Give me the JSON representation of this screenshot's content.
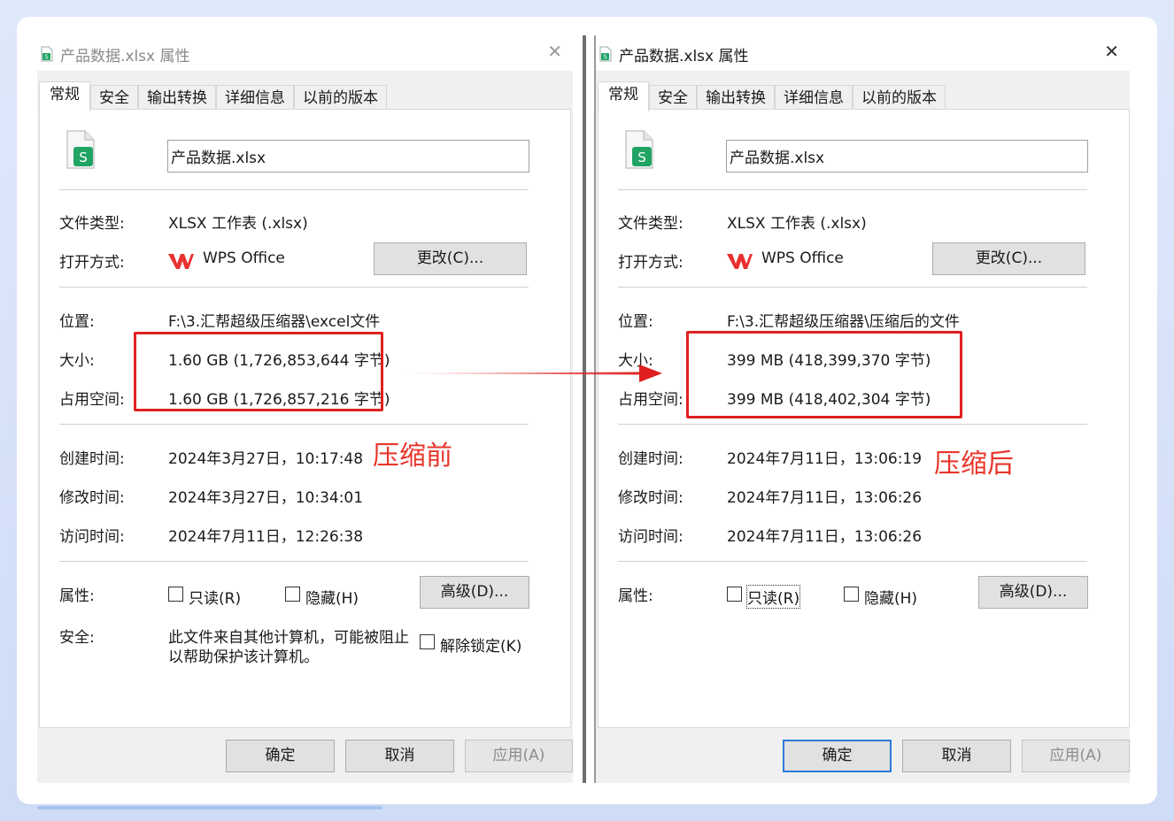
{
  "before": {
    "window_title": "产品数据.xlsx 属性",
    "close_icon": "close-icon",
    "tabs": [
      "常规",
      "安全",
      "输出转换",
      "详细信息",
      "以前的版本"
    ],
    "file_name": "产品数据.xlsx",
    "file_type_label": "文件类型:",
    "file_type_value": "XLSX 工作表 (.xlsx)",
    "open_with_label": "打开方式:",
    "open_with_app": "WPS Office",
    "change_button": "更改(C)...",
    "location_label": "位置:",
    "location_value": "F:\\3.汇帮超级压缩器\\excel文件",
    "size_label": "大小:",
    "size_value": "1.60 GB (1,726,853,644 字节)",
    "disk_size_label": "占用空间:",
    "disk_size_value": "1.60 GB (1,726,857,216 字节)",
    "created_label": "创建时间:",
    "created_value": "2024年3月27日，10:17:48",
    "modified_label": "修改时间:",
    "modified_value": "2024年3月27日，10:34:01",
    "accessed_label": "访问时间:",
    "accessed_value": "2024年7月11日，12:26:38",
    "attributes_label": "属性:",
    "readonly_label": "只读(R)",
    "hidden_label": "隐藏(H)",
    "advanced_button": "高级(D)...",
    "security_label": "安全:",
    "security_text_line1": "此文件来自其他计算机，可能被阻止",
    "security_text_line2": "以帮助保护该计算机。",
    "unblock_label": "解除锁定(K)",
    "ok_button": "确定",
    "cancel_button": "取消",
    "apply_button": "应用(A)"
  },
  "after": {
    "window_title": "产品数据.xlsx 属性",
    "close_icon": "close-icon",
    "tabs": [
      "常规",
      "安全",
      "输出转换",
      "详细信息",
      "以前的版本"
    ],
    "file_name": "产品数据.xlsx",
    "file_type_label": "文件类型:",
    "file_type_value": "XLSX 工作表 (.xlsx)",
    "open_with_label": "打开方式:",
    "open_with_app": "WPS Office",
    "change_button": "更改(C)...",
    "location_label": "位置:",
    "location_value": "F:\\3.汇帮超级压缩器\\压缩后的文件",
    "size_label": "大小:",
    "size_value": "399 MB (418,399,370 字节)",
    "disk_size_label": "占用空间:",
    "disk_size_value": "399 MB (418,402,304 字节)",
    "created_label": "创建时间:",
    "created_value": "2024年7月11日，13:06:19",
    "modified_label": "修改时间:",
    "modified_value": "2024年7月11日，13:06:26",
    "accessed_label": "访问时间:",
    "accessed_value": "2024年7月11日，13:06:26",
    "attributes_label": "属性:",
    "readonly_label": "只读(R)",
    "hidden_label": "隐藏(H)",
    "advanced_button": "高级(D)...",
    "ok_button": "确定",
    "cancel_button": "取消",
    "apply_button": "应用(A)"
  },
  "annotations": {
    "before_label": "压缩前",
    "after_label": "压缩后",
    "highlight_color": "#e02020"
  },
  "colors": {
    "sheet_icon_green": "#1fa463",
    "wps_red": "#e8312f",
    "default_button_border": "#2d7ad6"
  }
}
